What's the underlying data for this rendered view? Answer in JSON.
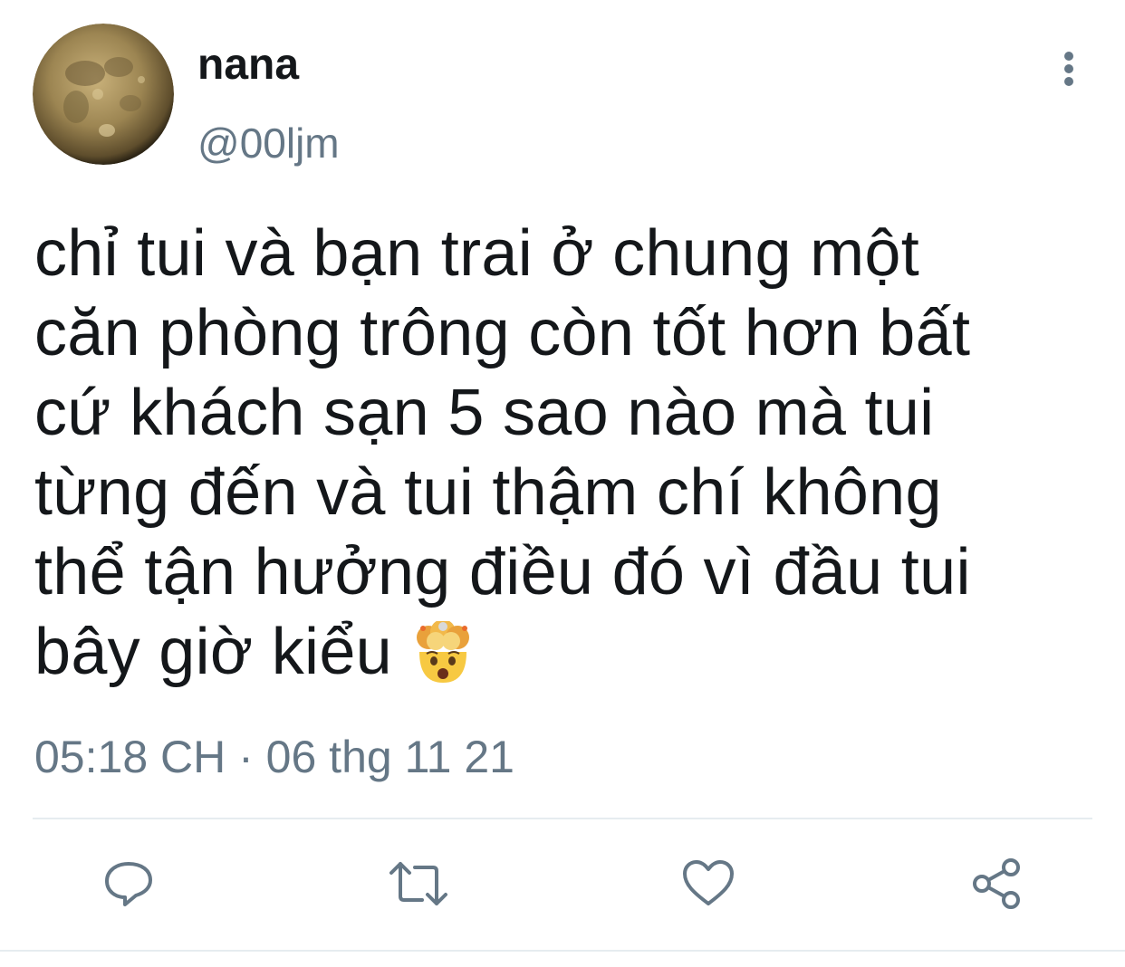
{
  "author": {
    "display_name": "nana",
    "handle": "@00ljm",
    "avatar_icon": "moon-avatar-icon"
  },
  "tweet": {
    "text": "chỉ tui và bạn trai ở chung một\ncăn phòng trông còn tốt hơn bất\ncứ khách sạn 5 sao nào mà tui\ntừng đến và tui thậm chí không\nthể tận hưởng điều đó vì đầu tui\nbây giờ kiểu ",
    "emoji": "exploding-head-emoji",
    "timestamp": "05:18 CH · 06 thg 11 21"
  },
  "actions": [
    {
      "name": "reply",
      "icon": "comment-icon"
    },
    {
      "name": "retweet",
      "icon": "retweet-icon"
    },
    {
      "name": "like",
      "icon": "heart-icon"
    },
    {
      "name": "share",
      "icon": "share-icon"
    }
  ],
  "colors": {
    "text": "#14171a",
    "secondary": "#657786",
    "divider": "#e6ecf0"
  }
}
